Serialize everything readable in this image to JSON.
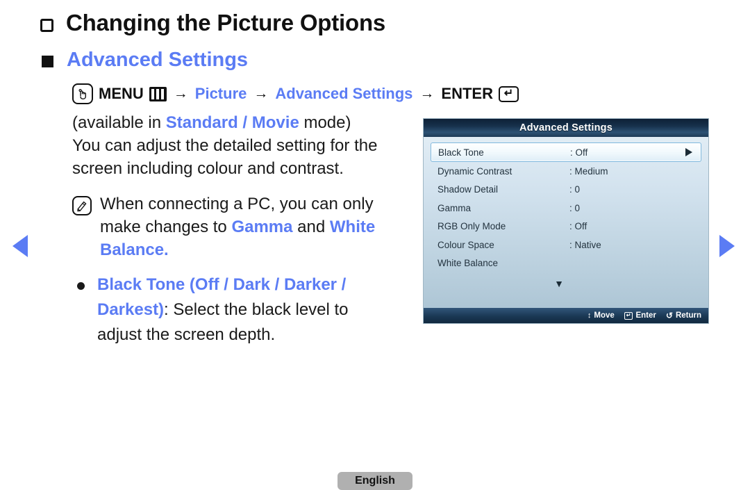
{
  "heading": {
    "title": "Changing the Picture Options",
    "subtitle": "Advanced Settings"
  },
  "menu_path": {
    "hand_icon": "hand-press-icon",
    "menu_label": "MENU",
    "menu_icon": "menu-grid-icon",
    "arrow1": "→",
    "step1": "Picture",
    "arrow2": "→",
    "step2": "Advanced Settings",
    "arrow3": "→",
    "enter_label": "ENTER",
    "enter_icon_glyph": "↵"
  },
  "body": {
    "availability_prefix": "(available in ",
    "availability_modes": "Standard / Movie",
    "availability_suffix": " mode)",
    "description_line1": "You can adjust the detailed setting for the",
    "description_line2": "screen including colour and contrast.",
    "note": {
      "icon": "note-pencil-icon",
      "text_part1": "When connecting a PC, you can only make changes to ",
      "text_highlight1": "Gamma",
      "text_part2": " and ",
      "text_highlight2": "White Balance."
    },
    "bullet": {
      "marker": "bullet-dot",
      "term": "Black Tone (Off / Dark / Darker / Darkest)",
      "definition": ": Select the black level to adjust the screen depth."
    }
  },
  "nav": {
    "prev_icon": "triangle-left-icon",
    "next_icon": "triangle-right-icon"
  },
  "osd": {
    "title": "Advanced Settings",
    "rows": [
      {
        "name": "Black Tone",
        "value": ": Off",
        "selected": true,
        "caret": true
      },
      {
        "name": "Dynamic Contrast",
        "value": ": Medium",
        "selected": false,
        "caret": false
      },
      {
        "name": "Shadow Detail",
        "value": ": 0",
        "selected": false,
        "caret": false
      },
      {
        "name": "Gamma",
        "value": ": 0",
        "selected": false,
        "caret": false
      },
      {
        "name": "RGB Only Mode",
        "value": ": Off",
        "selected": false,
        "caret": false
      },
      {
        "name": "Colour Space",
        "value": ": Native",
        "selected": false,
        "caret": false
      },
      {
        "name": "White Balance",
        "value": "",
        "selected": false,
        "caret": false
      }
    ],
    "scroll_more_glyph": "▼",
    "footer": {
      "move_icon": "↕",
      "move_label": "Move",
      "enter_icon": "↵",
      "enter_label": "Enter",
      "return_icon": "↺",
      "return_label": "Return"
    }
  },
  "footer": {
    "language": "English"
  },
  "colors": {
    "accent_blue": "#5b7cf4",
    "osd_title_navy": "#17314c",
    "osd_body": "#cfe0ec",
    "pill_gray": "#b0b0b0"
  }
}
